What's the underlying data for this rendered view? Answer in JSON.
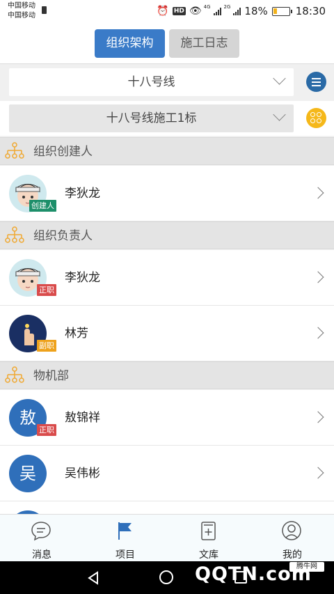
{
  "status_bar": {
    "carrier_1": "中国移动",
    "carrier_2": "中国移动",
    "network_1": "4G",
    "network_2": "2G",
    "battery": "18%",
    "time": "18:30"
  },
  "top_tabs": {
    "org_tab": "组织架构",
    "log_tab": "施工日志"
  },
  "filters": {
    "line": "十八号线",
    "section": "十八号线施工1标"
  },
  "groups": [
    {
      "title": "组织创建人",
      "members": [
        {
          "name": "李狄龙",
          "badge": "创建人",
          "avatar_char": ""
        }
      ]
    },
    {
      "title": "组织负责人",
      "members": [
        {
          "name": "李狄龙",
          "badge": "正职",
          "avatar_char": ""
        },
        {
          "name": "林芳",
          "badge": "副职",
          "avatar_char": ""
        }
      ]
    },
    {
      "title": "物机部",
      "members": [
        {
          "name": "敖锦祥",
          "badge": "正职",
          "avatar_char": "敖"
        },
        {
          "name": "吴伟彬",
          "badge": "",
          "avatar_char": "吴"
        }
      ]
    }
  ],
  "bottom_tabs": {
    "messages": "消息",
    "projects": "项目",
    "library": "文库",
    "mine": "我的"
  },
  "watermark": {
    "text": "QQTN.com",
    "small": "腾牛网"
  },
  "colors": {
    "primary": "#3a7bc8",
    "accent_orange": "#f5b81a",
    "badge_red": "#d94b4b",
    "badge_green": "#1d8f6a"
  }
}
